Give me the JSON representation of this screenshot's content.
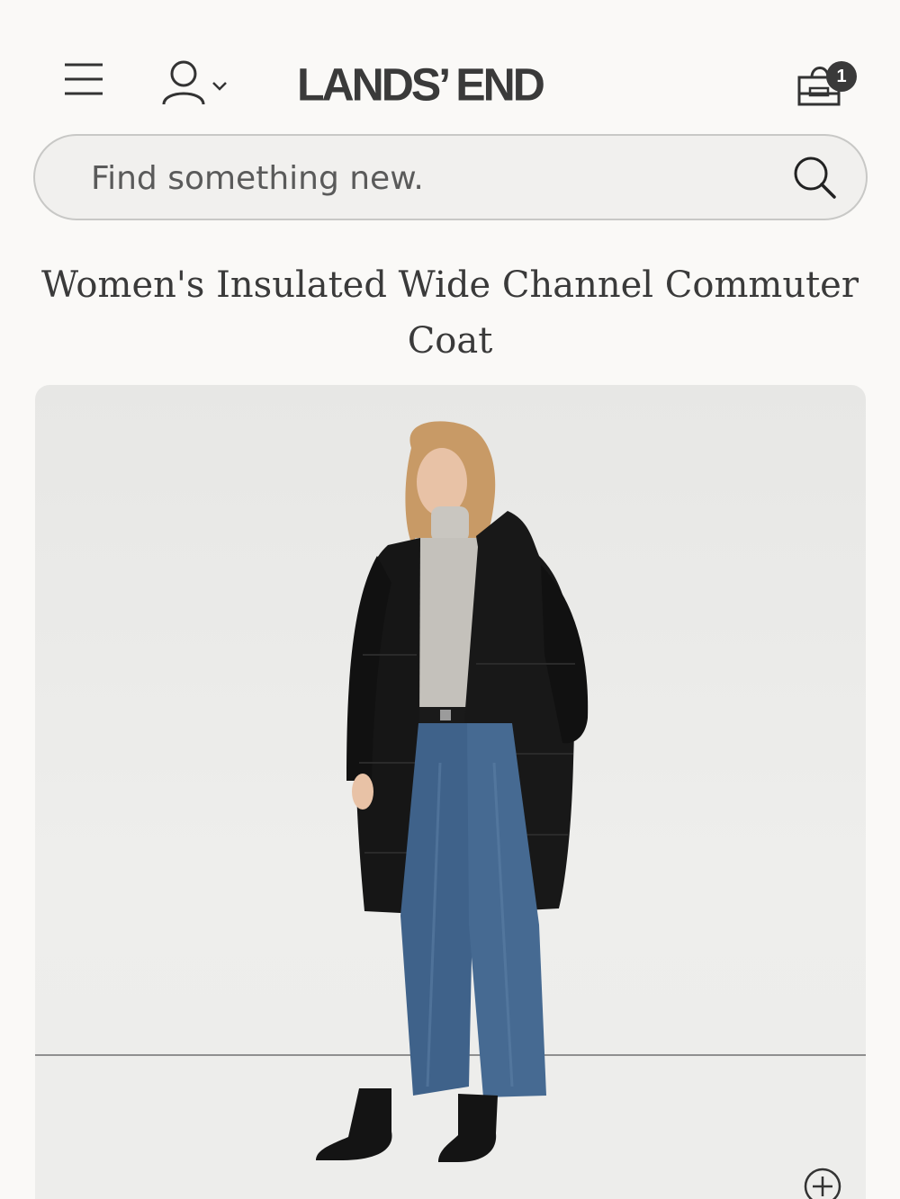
{
  "header": {
    "logo_text": "LANDS’ END",
    "cart_count": "1",
    "icons": {
      "menu": "hamburger-menu-icon",
      "account": "user-account-icon",
      "account_caret": "chevron-down-icon",
      "cart": "shopping-bag-icon"
    }
  },
  "search": {
    "placeholder": "Find something new.",
    "icon": "search-icon"
  },
  "product": {
    "title": "Women's Insulated Wide Channel Commuter Coat"
  },
  "image": {
    "alt": "Model wearing black insulated long puffer coat with grey turtleneck, wide-leg jeans and black boots",
    "zoom_icon": "zoom-plus-icon"
  },
  "colors": {
    "background": "#faf9f7",
    "text": "#3a3a3a",
    "search_bg": "#f1f0ee",
    "search_border": "#c8c8c6",
    "coat": "#161616",
    "jeans": "#3c5f86"
  }
}
